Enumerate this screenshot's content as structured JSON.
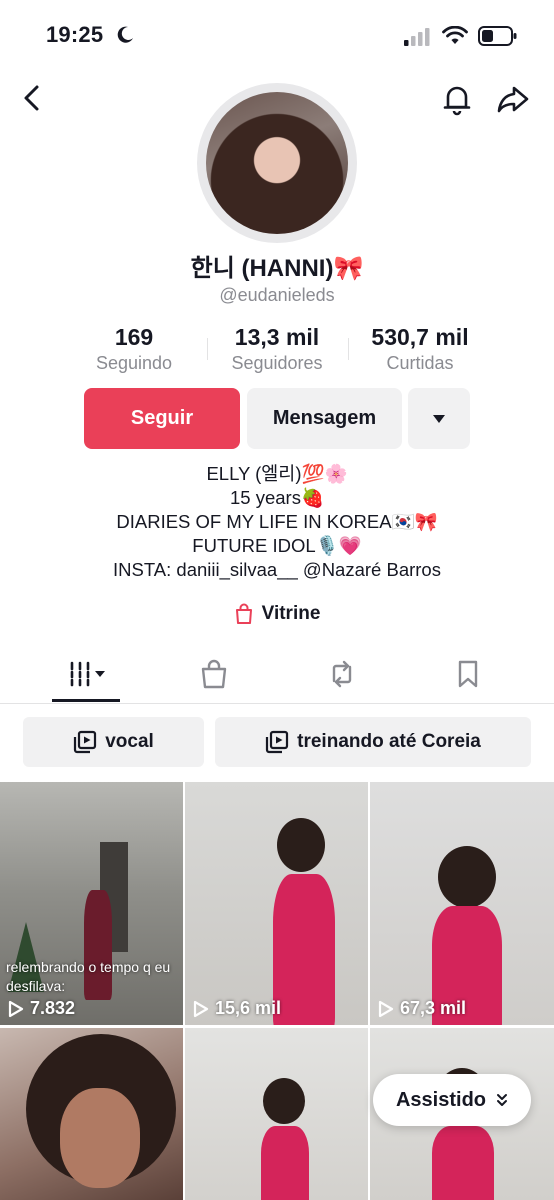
{
  "status_bar": {
    "time": "19:25"
  },
  "profile": {
    "display_name": "한니 (HANNI)🎀",
    "username": "@eudanieleds",
    "stats": [
      {
        "value": "169",
        "label": "Seguindo"
      },
      {
        "value": "13,3 mil",
        "label": "Seguidores"
      },
      {
        "value": "530,7 mil",
        "label": "Curtidas"
      }
    ],
    "follow_label": "Seguir",
    "message_label": "Mensagem",
    "bio_lines": [
      "ELLY (엘리)💯🌸",
      "15 years🍓",
      "DIARIES OF MY LIFE IN KOREA🇰🇷🎀",
      "FUTURE IDOL🎙️💗",
      "INSTA: daniii_silvaa__ @Nazaré Barros"
    ],
    "showcase_label": "Vitrine"
  },
  "playlists": [
    {
      "label": "vocal"
    },
    {
      "label": "treinando até Coreia"
    }
  ],
  "videos": [
    {
      "views": "7.832",
      "caption": "relembrando o tempo q eu desfilava:"
    },
    {
      "views": "15,6 mil"
    },
    {
      "views": "67,3 mil"
    },
    {},
    {},
    {}
  ],
  "watched_label": "Assistido",
  "colors": {
    "accent": "#ea4058",
    "text": "#161823",
    "muted": "#8a8b91",
    "chip": "#f1f1f2"
  }
}
